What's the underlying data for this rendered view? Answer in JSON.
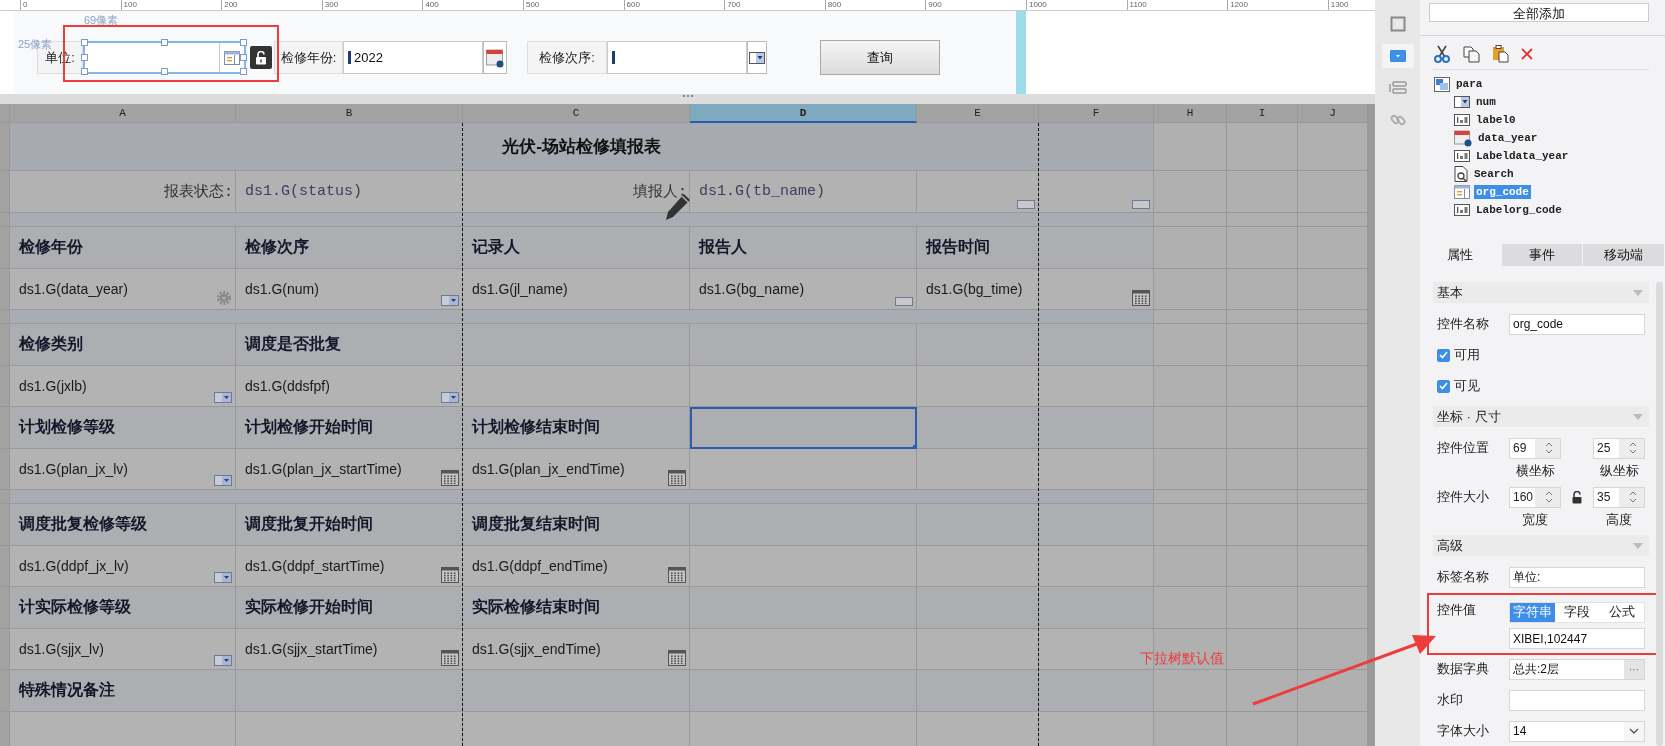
{
  "ruler": [
    "0",
    "100",
    "200",
    "300",
    "400",
    "500",
    "600",
    "700",
    "800",
    "900",
    "1000",
    "1100",
    "1200",
    "1300"
  ],
  "params": {
    "guides": [
      "69像素",
      "25像素"
    ],
    "controls": [
      {
        "kind": "tree",
        "label": "单位:",
        "selected": true
      },
      {
        "kind": "date",
        "label": "检修年份:",
        "value": "2022",
        "selected": false
      },
      {
        "kind": "dropdown",
        "label": "检修次序:",
        "selected": false
      }
    ],
    "button": "查询"
  },
  "grid": {
    "columns": [
      {
        "label": "A",
        "selected": false
      },
      {
        "label": "B",
        "selected": false
      },
      {
        "label": "C",
        "selected": false
      },
      {
        "label": "D",
        "selected": true
      },
      {
        "label": "E",
        "selected": false
      },
      {
        "label": "F",
        "selected": false
      },
      {
        "label": "H",
        "selected": false
      },
      {
        "label": "I",
        "selected": false
      },
      {
        "label": "J",
        "selected": false
      }
    ],
    "rows": [
      {
        "kind": "title",
        "text": "光伏-场站检修填报表"
      },
      {
        "kind": "status",
        "cells": [
          {
            "text": "报表状态:",
            "selected": false
          },
          {
            "text": "ds1.G(status)",
            "selected": false
          },
          {
            "text": "填报人:",
            "selected": false
          },
          {
            "text": "ds1.G(tb_name)",
            "selected": false
          },
          {
            "kind": "textbox",
            "selected": false
          },
          {
            "kind": "textbox",
            "selected": false
          }
        ]
      },
      {
        "kind": "spacer"
      },
      {
        "kind": "header",
        "cells": [
          {
            "text": "检修年份",
            "selected": false
          },
          {
            "text": "检修次序",
            "selected": false
          },
          {
            "text": "记录人",
            "selected": false
          },
          {
            "text": "报告人",
            "selected": false
          },
          {
            "text": "报告时间",
            "selected": false
          },
          {
            "selected": false
          }
        ]
      },
      {
        "kind": "data",
        "cells": [
          {
            "text": "ds1.G(data_year)",
            "kind": "gear",
            "selected": false
          },
          {
            "text": "ds1.G(num)",
            "kind": "dropdown",
            "selected": false
          },
          {
            "text": "ds1.G(jl_name)",
            "selected": false
          },
          {
            "text": "ds1.G(bg_name)",
            "kind": "textbox",
            "selected": false
          },
          {
            "text": "ds1.G(bg_time)",
            "selected": false
          },
          {
            "kind": "calendar",
            "selected": false
          }
        ]
      },
      {
        "kind": "spacer"
      },
      {
        "kind": "header",
        "cells": [
          {
            "text": "检修类别",
            "selected": false
          },
          {
            "text": "调度是否批复",
            "selected": false
          },
          {
            "selected": false
          },
          {
            "selected": false
          },
          {
            "selected": false
          },
          {
            "selected": false
          }
        ]
      },
      {
        "kind": "data",
        "cells": [
          {
            "text": "ds1.G(jxlb)",
            "kind": "dropdown",
            "selected": false
          },
          {
            "text": "ds1.G(ddsfpf)",
            "kind": "dropdown",
            "selected": false
          },
          {
            "selected": false
          },
          {
            "selected": false
          },
          {
            "selected": false
          },
          {
            "selected": false
          }
        ]
      },
      {
        "kind": "header",
        "cells": [
          {
            "text": "计划检修等级",
            "selected": false
          },
          {
            "text": "计划检修开始时间",
            "selected": false
          },
          {
            "text": "计划检修结束时间",
            "selected": false
          },
          {
            "selected": true
          },
          {
            "selected": false
          },
          {
            "selected": false
          }
        ]
      },
      {
        "kind": "data",
        "cells": [
          {
            "text": "ds1.G(plan_jx_lv)",
            "kind": "dropdown",
            "selected": false
          },
          {
            "text": "ds1.G(plan_jx_startTime)",
            "kind": "calendar",
            "selected": false
          },
          {
            "text": "ds1.G(plan_jx_endTime)",
            "kind": "calendar",
            "selected": false
          },
          {
            "selected": false
          },
          {
            "selected": false
          },
          {
            "selected": false
          }
        ]
      },
      {
        "kind": "spacer"
      },
      {
        "kind": "header",
        "cells": [
          {
            "text": "调度批复检修等级",
            "selected": false
          },
          {
            "text": "调度批复开始时间",
            "selected": false
          },
          {
            "text": "调度批复结束时间",
            "selected": false
          },
          {
            "selected": false
          },
          {
            "selected": false
          },
          {
            "selected": false
          }
        ]
      },
      {
        "kind": "data",
        "cells": [
          {
            "text": "ds1.G(ddpf_jx_lv)",
            "kind": "dropdown",
            "selected": false
          },
          {
            "text": "ds1.G(ddpf_startTime)",
            "kind": "calendar",
            "selected": false
          },
          {
            "text": "ds1.G(ddpf_endTime)",
            "kind": "calendar",
            "selected": false
          },
          {
            "selected": false
          },
          {
            "selected": false
          },
          {
            "selected": false
          }
        ]
      },
      {
        "kind": "header",
        "cells": [
          {
            "text": "计实际检修等级",
            "selected": false
          },
          {
            "text": "实际检修开始时间",
            "selected": false
          },
          {
            "text": "实际检修结束时间",
            "selected": false
          },
          {
            "selected": false
          },
          {
            "selected": false
          },
          {
            "selected": false
          }
        ]
      },
      {
        "kind": "data",
        "cells": [
          {
            "text": "ds1.G(sjjx_lv)",
            "kind": "dropdown",
            "selected": false
          },
          {
            "text": "ds1.G(sjjx_startTime)",
            "kind": "calendar",
            "selected": false
          },
          {
            "text": "ds1.G(sjjx_endTime)",
            "kind": "calendar",
            "selected": false
          },
          {
            "selected": false
          },
          {
            "selected": false
          },
          {
            "selected": false
          }
        ]
      },
      {
        "kind": "header",
        "cells": [
          {
            "text": "特殊情况备注",
            "selected": false
          },
          {
            "selected": false
          },
          {
            "selected": false
          },
          {
            "selected": false
          },
          {
            "selected": false
          },
          {
            "selected": false
          }
        ]
      },
      {
        "kind": "data",
        "cells": [
          {
            "selected": false
          },
          {
            "selected": false
          },
          {
            "selected": false
          },
          {
            "selected": false
          },
          {
            "selected": false
          },
          {
            "selected": false
          }
        ]
      }
    ]
  },
  "tool_strip": [
    {
      "selected": false
    },
    {
      "selected": true
    },
    {
      "selected": false
    },
    {
      "selected": false
    }
  ],
  "right_panel": {
    "add_all_button": "全部添加",
    "tree": {
      "label": "para",
      "kind": "panel",
      "children": [
        {
          "label": "num",
          "kind": "dropdown",
          "selected": false
        },
        {
          "label": "label0",
          "kind": "label",
          "selected": false
        },
        {
          "label": "data_year",
          "kind": "date",
          "selected": false
        },
        {
          "label": "Labeldata_year",
          "kind": "label",
          "selected": false
        },
        {
          "label": "Search",
          "kind": "search",
          "selected": false
        },
        {
          "label": "org_code",
          "kind": "tree",
          "selected": true
        },
        {
          "label": "Labelorg_code",
          "kind": "label",
          "selected": false
        }
      ]
    },
    "tabs": [
      {
        "label": "属性",
        "selected": true
      },
      {
        "label": "事件",
        "selected": false
      },
      {
        "label": "移动端",
        "selected": false
      }
    ],
    "sections": [
      {
        "title": "基本",
        "rows": [
          {
            "kind": "text",
            "label": "控件名称",
            "value": "org_code"
          },
          {
            "kind": "checkbox",
            "label": "可用",
            "checked": true
          },
          {
            "kind": "checkbox",
            "label": "可见",
            "checked": true
          }
        ]
      },
      {
        "title": "坐标 · 尺寸",
        "rows": [
          {
            "kind": "pair",
            "label": "控件位置",
            "values": [
              {
                "value": "69",
                "caption": "横坐标"
              },
              {
                "value": "25",
                "caption": "纵坐标"
              }
            ]
          },
          {
            "kind": "pair",
            "label": "控件大小",
            "locked": false,
            "values": [
              {
                "value": "160",
                "caption": "宽度"
              },
              {
                "value": "35",
                "caption": "高度"
              }
            ]
          }
        ]
      },
      {
        "title": "高级",
        "rows": [
          {
            "kind": "text",
            "label": "标签名称",
            "value": "单位:"
          },
          {
            "kind": "mode",
            "label": "控件值",
            "options": [
              {
                "label": "字符串",
                "selected": true
              },
              {
                "label": "字段",
                "selected": false
              },
              {
                "label": "公式",
                "selected": false
              }
            ],
            "value": "XIBEI,102447"
          },
          {
            "kind": "dict",
            "label": "数据字典",
            "value": "总共:2层",
            "button": "···"
          },
          {
            "kind": "text",
            "label": "水印"
          },
          {
            "kind": "select",
            "label": "字体大小",
            "value": "14"
          }
        ]
      }
    ]
  },
  "annotation": {
    "text": "下拉树默认值"
  }
}
